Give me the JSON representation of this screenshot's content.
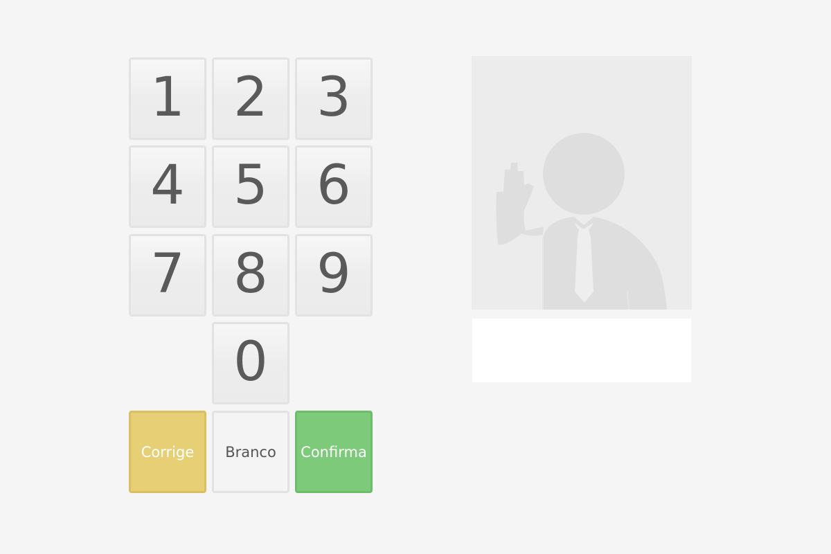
{
  "keypad": {
    "keys": [
      "1",
      "2",
      "3",
      "4",
      "5",
      "6",
      "7",
      "8",
      "9",
      "0"
    ]
  },
  "actions": {
    "corrige_label": "Corrige",
    "branco_label": "Branco",
    "confirma_label": "Confirma"
  },
  "candidate": {
    "photo_icon": "person-waving-icon",
    "name": ""
  },
  "colors": {
    "background": "#f5f5f5",
    "key_face": "#ededed",
    "key_text": "#5a5a5a",
    "corrige": "#e6cf75",
    "branco": "#f4f4f4",
    "confirma": "#7cca7a",
    "placeholder": "#dedede"
  }
}
